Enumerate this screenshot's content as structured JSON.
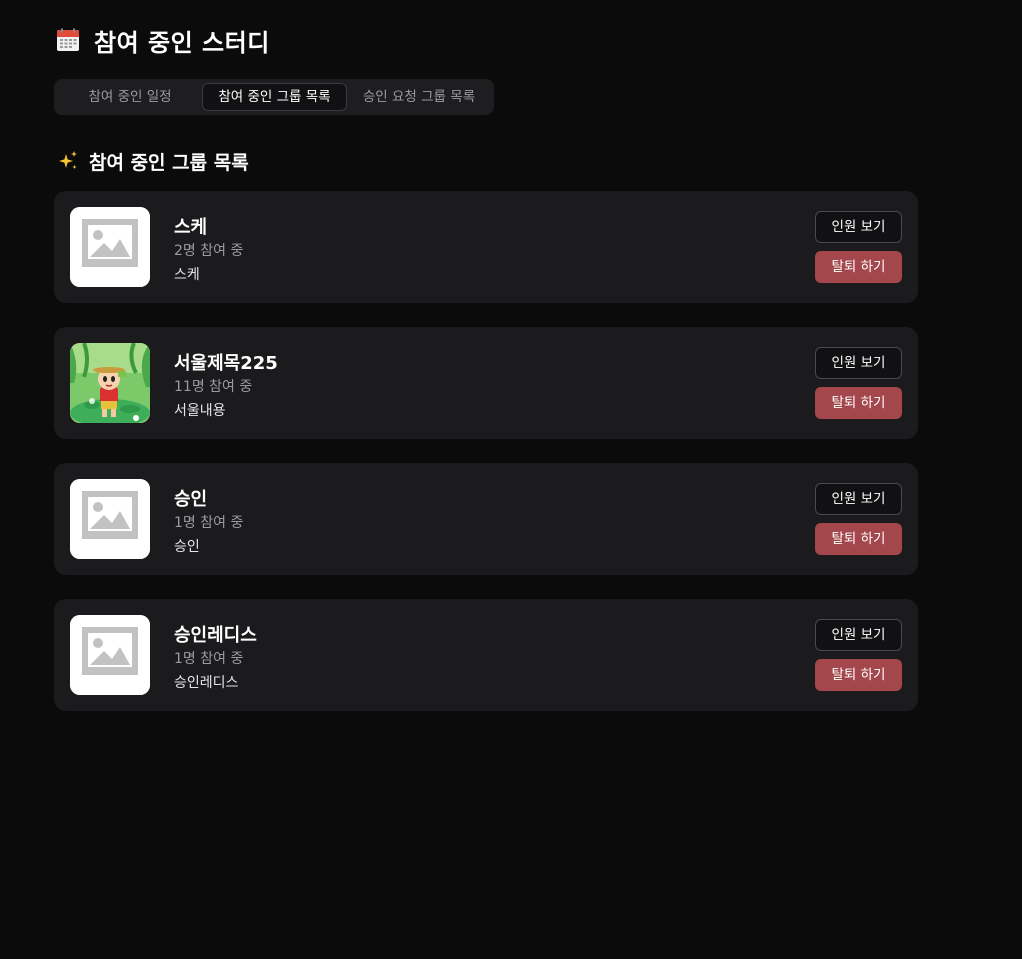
{
  "header": {
    "title": "참여 중인 스터디",
    "icon": "calendar-icon"
  },
  "tabs": [
    {
      "label": "참여 중인 일정",
      "active": false
    },
    {
      "label": "참여 중인 그룹 목록",
      "active": true
    },
    {
      "label": "승인 요청 그룹 목록",
      "active": false
    }
  ],
  "section": {
    "title": "참여 중인 그룹 목록",
    "icon": "sparkle-icon"
  },
  "buttons": {
    "members_label": "인원 보기",
    "leave_label": "탈퇴 하기"
  },
  "groups": [
    {
      "name": "스케",
      "members": "2명 참여 중",
      "description": "스케",
      "image": "placeholder-image-icon"
    },
    {
      "name": "서울제목225",
      "members": "11명 참여 중",
      "description": "서울내용",
      "image": "cartoon-character-image"
    },
    {
      "name": "승인",
      "members": "1명 참여 중",
      "description": "승인",
      "image": "placeholder-image-icon"
    },
    {
      "name": "승인레디스",
      "members": "1명 참여 중",
      "description": "승인레디스",
      "image": "placeholder-image-icon"
    }
  ],
  "colors": {
    "background": "#0b0b0b",
    "card": "#1b1b1d",
    "leave_button": "#a4474c",
    "muted_text": "#9a9aa0"
  }
}
